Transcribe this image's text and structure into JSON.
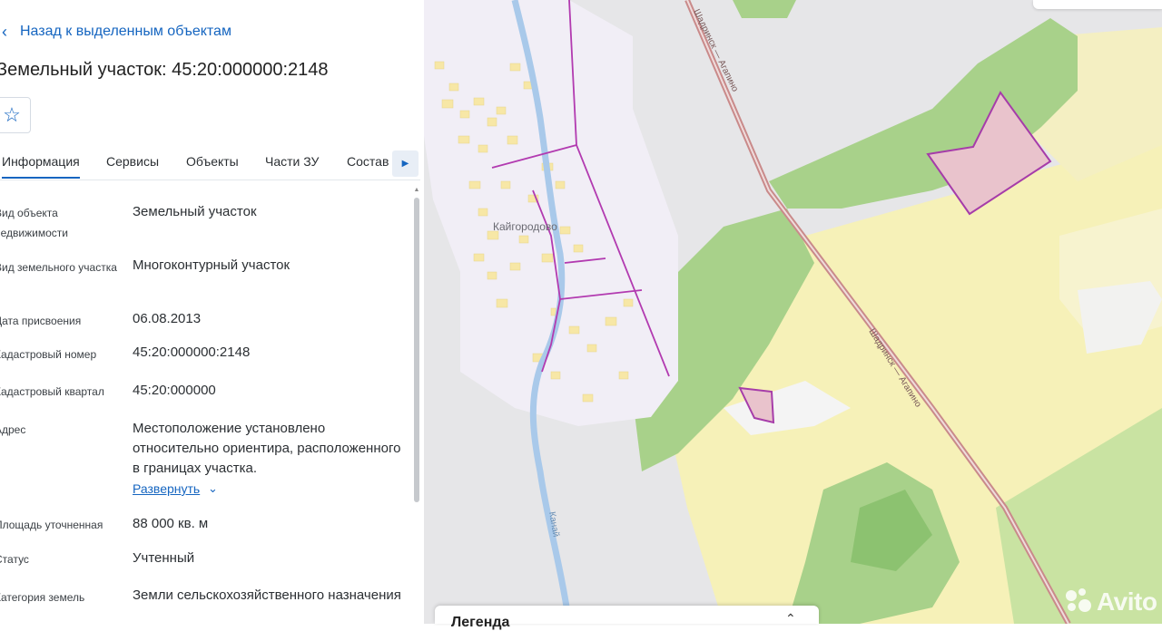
{
  "back_link": {
    "label": "Назад к выделенным объектам"
  },
  "title": "Земельный участок: 45:20:000000:2148",
  "tabs": [
    {
      "label": "Информация",
      "active": true
    },
    {
      "label": "Сервисы",
      "active": false
    },
    {
      "label": "Объекты",
      "active": false
    },
    {
      "label": "Части ЗУ",
      "active": false
    },
    {
      "label": "Состав",
      "active": false
    }
  ],
  "properties": [
    {
      "label": "Вид объекта недвижимости",
      "value": "Земельный участок"
    },
    {
      "label": "Вид земельного участка",
      "value": "Многоконтурный участок"
    },
    {
      "label": "Дата присвоения",
      "value": "06.08.2013"
    },
    {
      "label": "Кадастровый номер",
      "value": "45:20:000000:2148"
    },
    {
      "label": "Кадастровый квартал",
      "value": "45:20:000000"
    },
    {
      "label": "Адрес",
      "value": "Местоположение установлено относительно ориентира, расположенного в границах участка."
    },
    {
      "label": "Площадь уточненная",
      "value": "88 000 кв. м"
    },
    {
      "label": "Статус",
      "value": "Учтенный"
    },
    {
      "label": "Категория земель",
      "value": "Земли сельскохозяйственного назначения"
    }
  ],
  "expand_link": "Развернуть",
  "map": {
    "village_label": "Кайгородово",
    "road_label_1": "Шадринск — Агапино",
    "road_label_2": "Шадринск — Агапино",
    "river_label": "Канай",
    "colors": {
      "forest": "#a8d18a",
      "forest_dark": "#8cc270",
      "field": "#f6f1b8",
      "village": "#f1eef6",
      "parcel_fill": "#e9c3cc",
      "parcel_stroke": "#a63ca9",
      "river": "#a9c9ea",
      "road": "#c98a8a"
    }
  },
  "legend": {
    "title": "Легенда"
  },
  "watermark": "Avito"
}
